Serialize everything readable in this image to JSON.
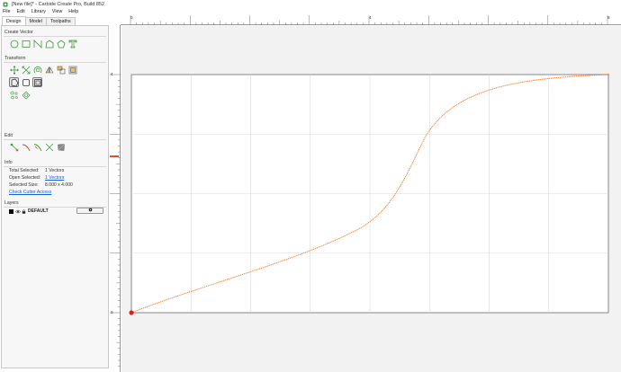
{
  "window": {
    "title": "[New file]* - Carbide Create Pro, Build 852",
    "logo_icon": "carbide-logo-icon"
  },
  "menu": {
    "items": [
      "File",
      "Edit",
      "Library",
      "View",
      "Help"
    ]
  },
  "tabs": {
    "items": [
      "Design",
      "Model",
      "Toolpaths"
    ],
    "active": "Design"
  },
  "sidebar": {
    "create_vector": {
      "label": "Create Vector",
      "tools": [
        "circle-tool-icon",
        "rectangle-tool-icon",
        "polyline-tool-icon",
        "curve-tool-icon",
        "polygon-tool-icon",
        "text-tool-icon"
      ]
    },
    "transform": {
      "label": "Transform",
      "tools": [
        "move-tool-icon",
        "scale-tool-icon",
        "rotate-tool-icon",
        "mirror-tool-icon",
        "align-tool-icon",
        "offset-tool-icon",
        "fillet-tool-icon",
        "boolean-tool-icon",
        "array-tool-icon",
        "circular-array-tool-icon"
      ]
    },
    "edit": {
      "label": "Edit",
      "tools": [
        "node-edit-tool-icon",
        "trim-tool-icon",
        "trim-vectors-icon",
        "join-tool-icon",
        "measure-tool-icon"
      ]
    },
    "info": {
      "label": "Info",
      "total_selected_label": "Total Selected:",
      "total_selected_value": "1 Vectors",
      "open_selected_label": "Open Selected:",
      "open_selected_value": "1 Vectors",
      "selected_size_label": "Selected Size:",
      "selected_size_value": "8.000 x 4.000",
      "check_cutter_access": "Check Cutter Access"
    },
    "layers": {
      "label": "Layers",
      "items": [
        {
          "name": "DEFAULT",
          "color": "#000000"
        }
      ],
      "options_icon": "gear-icon",
      "add_label": "+"
    }
  },
  "rulers": {
    "top": [
      "0",
      "4",
      "8"
    ],
    "left": [
      "4",
      "0"
    ]
  },
  "colors": {
    "curve": "#f07a2a",
    "grid": "#d9d9d9",
    "outside": "#f2f2f2",
    "selection_marker": "#e02020",
    "ruler_marker": "#e05020"
  }
}
